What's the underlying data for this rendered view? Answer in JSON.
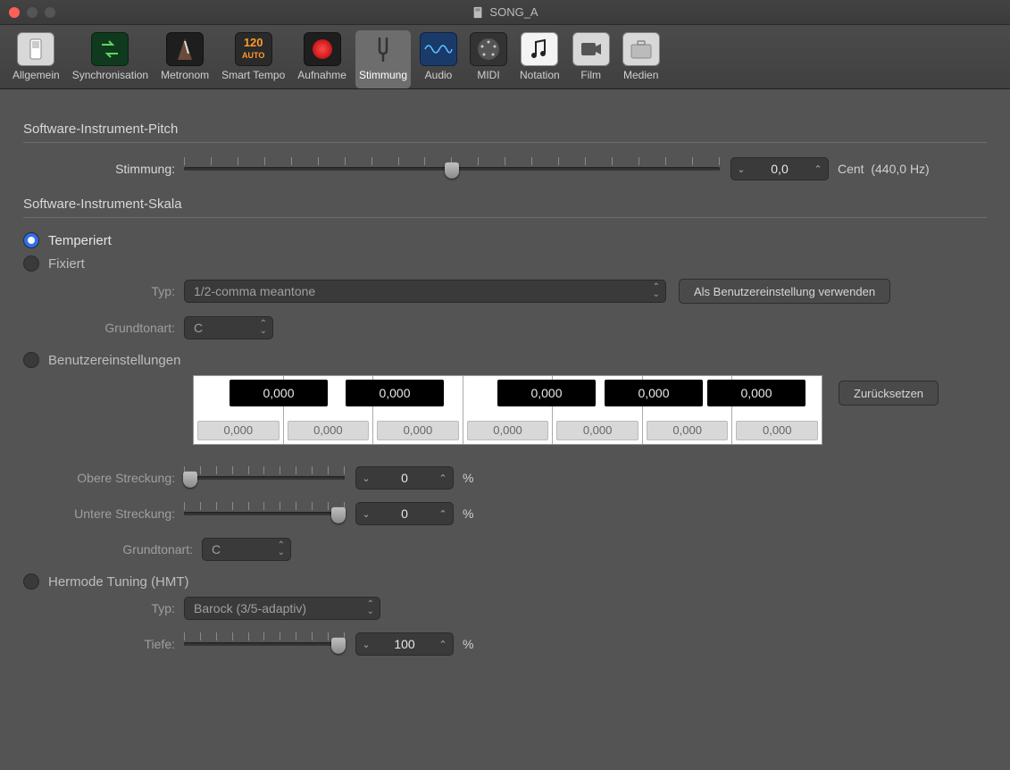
{
  "window": {
    "title": "SONG_A"
  },
  "toolbar": {
    "items": [
      {
        "label": "Allgemein",
        "name": "tab-allgemein"
      },
      {
        "label": "Synchronisation",
        "name": "tab-synchronisation"
      },
      {
        "label": "Metronom",
        "name": "tab-metronom"
      },
      {
        "label": "Smart Tempo",
        "name": "tab-smart-tempo"
      },
      {
        "label": "Aufnahme",
        "name": "tab-aufnahme"
      },
      {
        "label": "Stimmung",
        "name": "tab-stimmung",
        "active": true
      },
      {
        "label": "Audio",
        "name": "tab-audio"
      },
      {
        "label": "MIDI",
        "name": "tab-midi"
      },
      {
        "label": "Notation",
        "name": "tab-notation"
      },
      {
        "label": "Film",
        "name": "tab-film"
      },
      {
        "label": "Medien",
        "name": "tab-medien"
      }
    ]
  },
  "pitch": {
    "section": "Software-Instrument-Pitch",
    "tune_label": "Stimmung:",
    "value": "0,0",
    "unit": "Cent",
    "ref": "(440,0 Hz)"
  },
  "scale": {
    "section": "Software-Instrument-Skala",
    "tempered": "Temperiert",
    "fixed": "Fixiert",
    "type_label": "Typ:",
    "type_value": "1/2-comma meantone",
    "use_as_default": "Als Benutzereinstellung verwenden",
    "root_label": "Grundtonart:",
    "root_value": "C",
    "user_settings": "Benutzereinstellungen",
    "reset": "Zurücksetzen",
    "black_keys": [
      "0,000",
      "0,000",
      "0,000",
      "0,000",
      "0,000"
    ],
    "white_keys": [
      "0,000",
      "0,000",
      "0,000",
      "0,000",
      "0,000",
      "0,000",
      "0,000"
    ],
    "upper_label": "Obere Streckung:",
    "upper_value": "0",
    "upper_unit": "%",
    "lower_label": "Untere Streckung:",
    "lower_value": "0",
    "lower_unit": "%",
    "root2_label": "Grundtonart:",
    "root2_value": "C"
  },
  "hmt": {
    "title": "Hermode Tuning (HMT)",
    "type_label": "Typ:",
    "type_value": "Barock (3/5-adaptiv)",
    "depth_label": "Tiefe:",
    "depth_value": "100",
    "depth_unit": "%"
  }
}
